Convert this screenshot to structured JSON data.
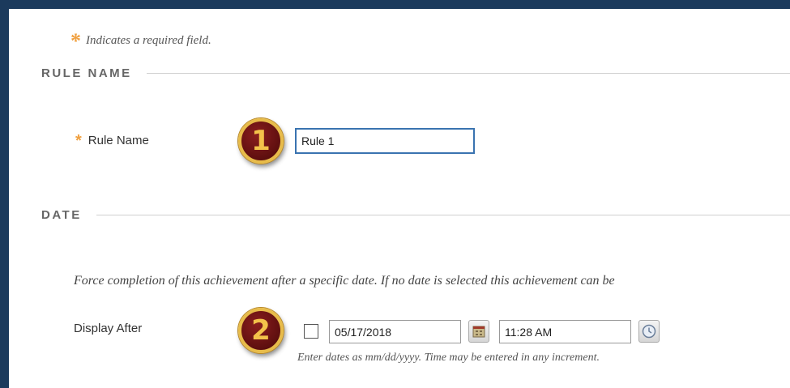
{
  "required_note": {
    "asterisk": "*",
    "text": "Indicates a required field."
  },
  "sections": {
    "rule_name": {
      "title": "RULE NAME"
    },
    "date": {
      "title": "DATE"
    }
  },
  "rule_name_field": {
    "asterisk": "*",
    "label": "Rule Name",
    "value": "Rule 1",
    "step_badge": "1"
  },
  "date_section": {
    "description": "Force completion of this achievement after a specific date. If no date is selected this achievement can be",
    "display_after": {
      "label": "Display After",
      "step_badge": "2",
      "checked": false,
      "date_value": "05/17/2018",
      "time_value": "11:28 AM",
      "help_text": "Enter dates as mm/dd/yyyy. Time may be entered in any increment."
    }
  },
  "colors": {
    "frame": "#1b3a5c",
    "asterisk": "#f0a040",
    "focus_border": "#3a73b0",
    "badge_fill": "#6b1414",
    "badge_ring": "#e8bc4a"
  }
}
